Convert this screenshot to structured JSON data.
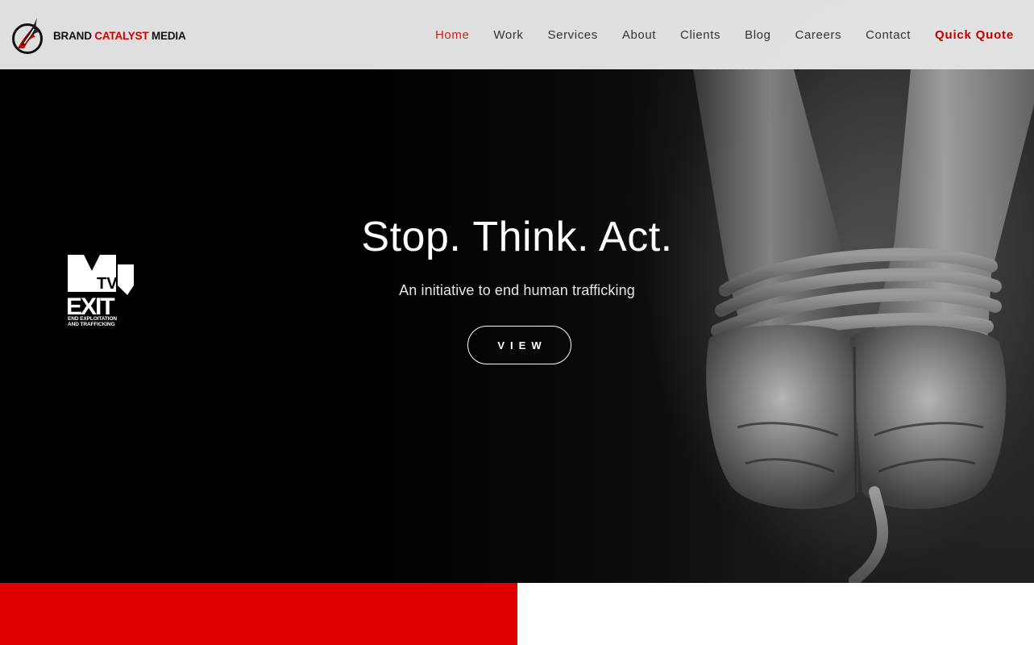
{
  "brand": {
    "name_part1": "BRAND",
    "name_accent": "CATALYST",
    "name_part2": "MEDIA",
    "logo_icon": "flame-circle-icon"
  },
  "nav": {
    "items": [
      {
        "label": "Home",
        "active": true
      },
      {
        "label": "Work"
      },
      {
        "label": "Services"
      },
      {
        "label": "About"
      },
      {
        "label": "Clients"
      },
      {
        "label": "Blog"
      },
      {
        "label": "Careers"
      },
      {
        "label": "Contact"
      }
    ],
    "quote_label": "Quick Quote"
  },
  "hero": {
    "title": "Stop. Think. Act.",
    "subtitle": "An initiative to end human trafficking",
    "button_label": "VIEW",
    "partner_logo": {
      "top": "MTV",
      "main": "EXIT",
      "sub_line1": "END EXPLOITATION",
      "sub_line2": "AND TRAFFICKING"
    }
  },
  "colors": {
    "accent": "#e00000",
    "nav_active": "#c9241b",
    "quote": "#c00000",
    "header_bg": "#ebebeb"
  }
}
